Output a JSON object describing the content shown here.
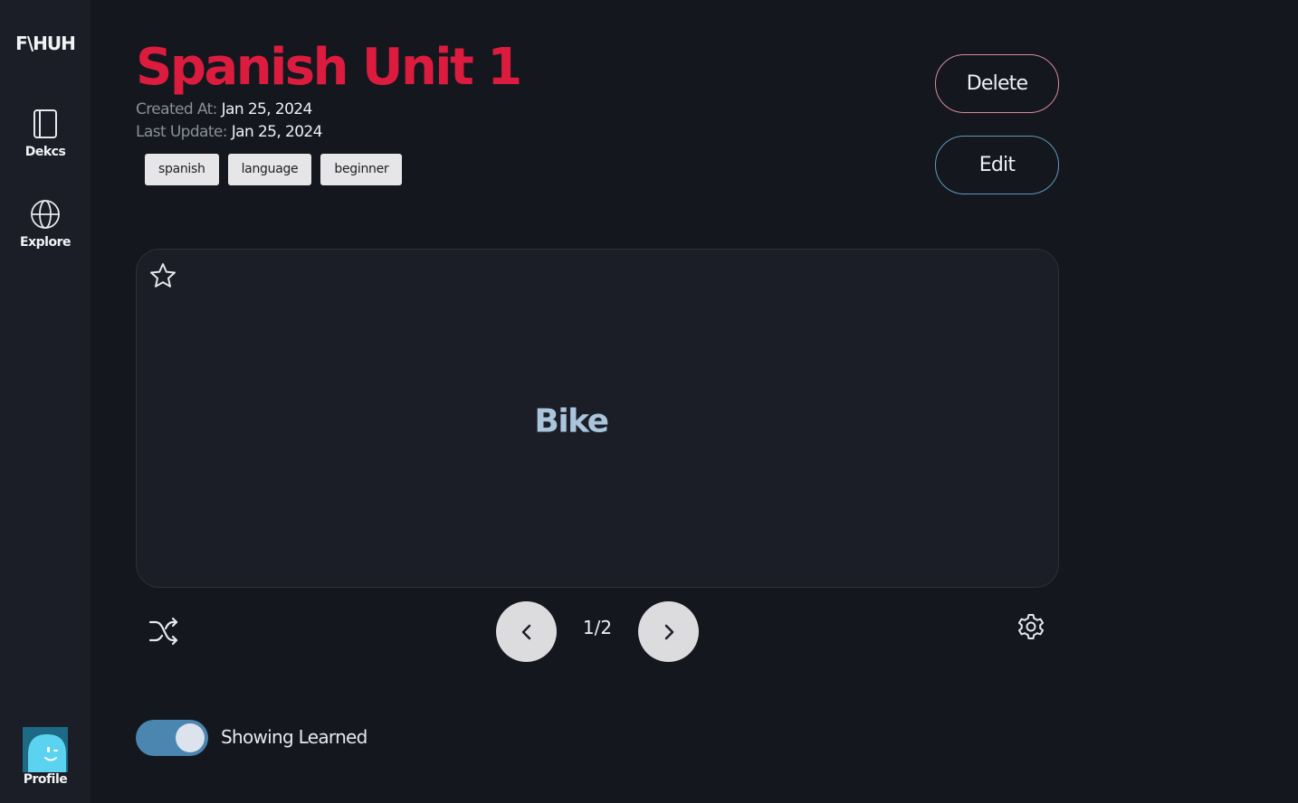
{
  "sidebar": {
    "logo": "F\\HUH",
    "items": [
      {
        "label": "Dekcs",
        "icon": "book-icon"
      },
      {
        "label": "Explore",
        "icon": "globe-icon"
      }
    ],
    "profile": {
      "label": "Profile",
      "icon": "avatar-icon"
    }
  },
  "deck": {
    "title": "Spanish Unit 1",
    "created_label": "Created At:",
    "created_value": "Jan 25, 2024",
    "updated_label": "Last Update:",
    "updated_value": "Jan 25, 2024",
    "tags": [
      "spanish",
      "language",
      "beginner"
    ]
  },
  "actions": {
    "delete_label": "Delete",
    "edit_label": "Edit"
  },
  "card": {
    "text": "Bike",
    "favorite_icon": "star-icon"
  },
  "controls": {
    "counter": "1/2",
    "shuffle_icon": "shuffle-icon",
    "prev_icon": "chevron-left-icon",
    "next_icon": "chevron-right-icon",
    "settings_icon": "gear-icon"
  },
  "filter": {
    "toggle_label": "Showing Learned",
    "toggle_on": true
  },
  "colors": {
    "title": "#dc1c3e",
    "card_text": "#a9c4db",
    "toggle": "#4a86b0",
    "delete_border": "#d98a96",
    "edit_border": "#5e9bb8"
  }
}
